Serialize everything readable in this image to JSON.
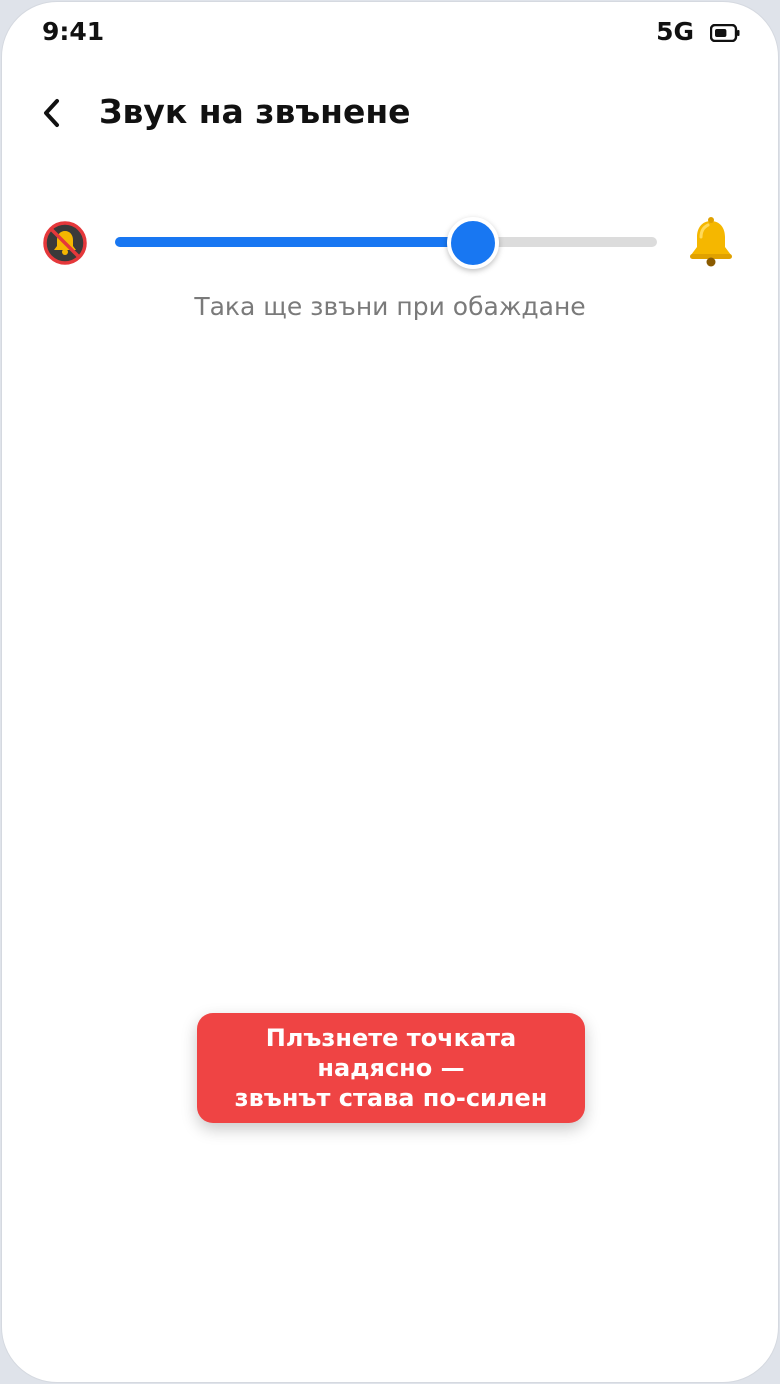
{
  "status_bar": {
    "time": "9:41",
    "network": "5G",
    "battery_icon": "battery-icon",
    "battery_level": 0.6
  },
  "header": {
    "back_icon": "chevron-left-icon",
    "title": "Звук на звънене"
  },
  "ringtone_slider": {
    "min_icon": "bell-muted-icon",
    "max_icon": "bell-icon",
    "value": 0.66,
    "caption": "Така ще звъни при обаждане"
  },
  "toast": {
    "lines": [
      "Плъзнете точката",
      "надясно —",
      "звънът става по-силен"
    ]
  },
  "colors": {
    "accent": "#1877f2",
    "track": "#dcdcdc",
    "toast_background": "#ef4444",
    "mute_badge": "#e5383b",
    "bell": "#f5b700"
  }
}
